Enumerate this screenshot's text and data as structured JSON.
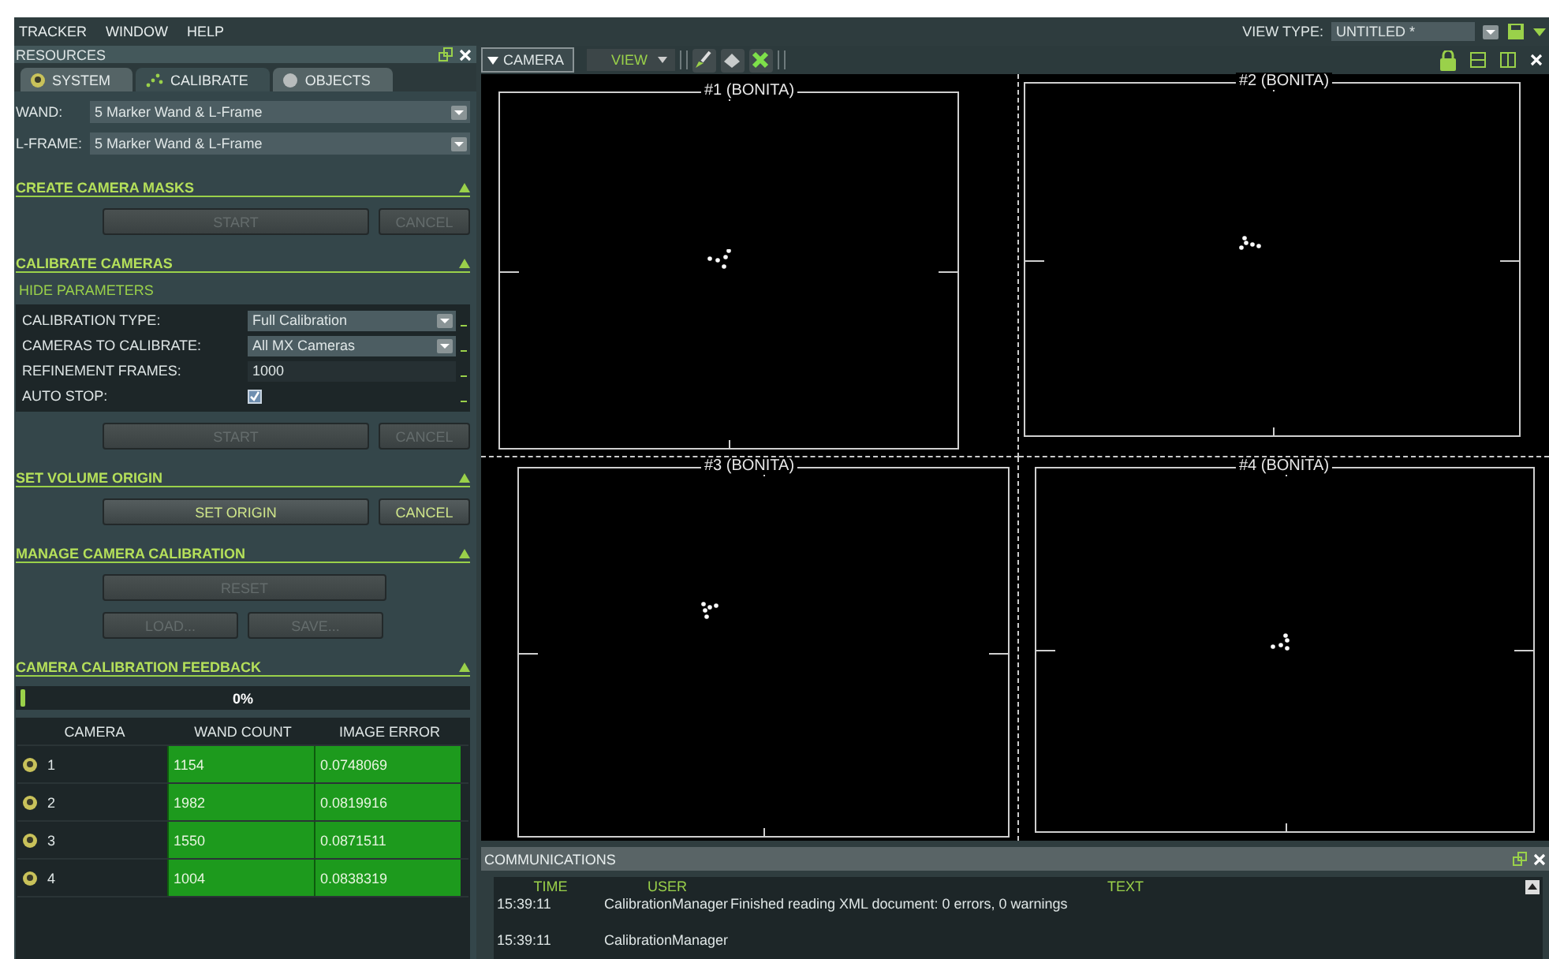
{
  "menu": [
    "TRACKER",
    "WINDOW",
    "HELP"
  ],
  "view_type": {
    "label": "VIEW TYPE:",
    "value": "UNTITLED *"
  },
  "resources": {
    "title": "RESOURCES",
    "tabs": [
      {
        "label": "SYSTEM",
        "selected": false
      },
      {
        "label": "CALIBRATE",
        "selected": true
      },
      {
        "label": "OBJECTS",
        "selected": false
      }
    ],
    "selectors": [
      {
        "label": "WAND:",
        "value": "5 Marker Wand & L-Frame"
      },
      {
        "label": "L-FRAME:",
        "value": "5 Marker Wand & L-Frame"
      }
    ],
    "sections": [
      {
        "title": "CREATE CAMERA MASKS",
        "expanded": true,
        "buttons": [
          {
            "label": "START",
            "disabled": true
          },
          {
            "label": "CANCEL",
            "disabled": true
          }
        ]
      },
      {
        "title": "CALIBRATE CAMERAS",
        "expanded": true,
        "link": "HIDE PARAMETERS",
        "params": [
          {
            "label": "CALIBRATION TYPE:",
            "kind": "dropdown",
            "value": "Full Calibration"
          },
          {
            "label": "CAMERAS TO CALIBRATE:",
            "kind": "dropdown",
            "value": "All MX Cameras"
          },
          {
            "label": "REFINEMENT FRAMES:",
            "kind": "number",
            "value": "1000"
          },
          {
            "label": "AUTO STOP:",
            "kind": "checkbox",
            "checked": true
          }
        ],
        "buttons": [
          {
            "label": "START",
            "disabled": true
          },
          {
            "label": "CANCEL",
            "disabled": true
          }
        ]
      },
      {
        "title": "SET VOLUME ORIGIN",
        "expanded": true,
        "buttons": [
          {
            "label": "SET ORIGIN",
            "disabled": false
          },
          {
            "label": "CANCEL",
            "disabled": false
          }
        ]
      },
      {
        "title": "MANAGE CAMERA CALIBRATION",
        "expanded": true,
        "button_rows": [
          [
            {
              "label": "RESET",
              "disabled": true
            }
          ],
          [
            {
              "label": "LOAD...",
              "disabled": true
            },
            {
              "label": "SAVE...",
              "disabled": true
            }
          ]
        ]
      },
      {
        "title": "CAMERA CALIBRATION FEEDBACK",
        "expanded": true,
        "progress": {
          "level": 0,
          "reading": "0%"
        },
        "table": {
          "columns": [
            "CAMERA",
            "WAND COUNT",
            "IMAGE ERROR"
          ],
          "rows": [
            {
              "camera": "1",
              "wand_count": "1154",
              "image_error": "0.0748069"
            },
            {
              "camera": "2",
              "wand_count": "1982",
              "image_error": "0.0819916"
            },
            {
              "camera": "3",
              "wand_count": "1550",
              "image_error": "0.0871511"
            },
            {
              "camera": "4",
              "wand_count": "1004",
              "image_error": "0.0838319"
            }
          ]
        }
      }
    ]
  },
  "camera_pane": {
    "tab": "CAMERA",
    "view_menu": "VIEW",
    "viewports": [
      {
        "title": "#1 (BONITA)"
      },
      {
        "title": "#2 (BONITA)"
      },
      {
        "title": "#3 (BONITA)"
      },
      {
        "title": "#4 (BONITA)"
      }
    ]
  },
  "communications": {
    "title": "COMMUNICATIONS",
    "columns": [
      "TIME",
      "USER",
      "TEXT"
    ],
    "rows": [
      {
        "time": "15:39:11",
        "user": "CalibrationManager",
        "text": "Finished reading XML document: 0 errors, 0 warnings"
      },
      {
        "time": "15:39:11",
        "user": "CalibrationManager"
      }
    ]
  }
}
